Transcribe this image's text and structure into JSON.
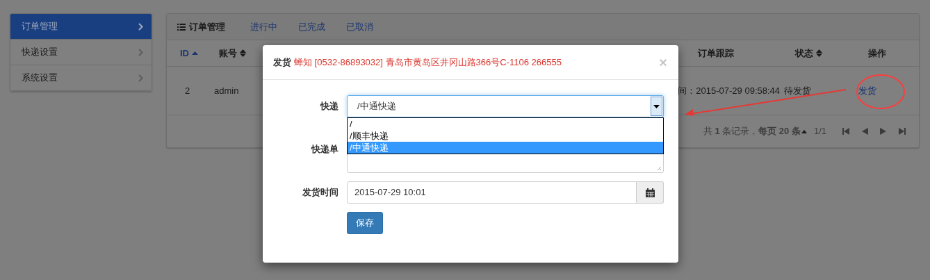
{
  "sidebar": {
    "items": [
      {
        "label": "订单管理",
        "selected": true
      },
      {
        "label": "快递设置",
        "selected": false
      },
      {
        "label": "系统设置",
        "selected": false
      }
    ]
  },
  "panel": {
    "title": "订单管理",
    "links": [
      "进行中",
      "已完成",
      "已取消"
    ]
  },
  "table": {
    "columns": [
      {
        "label": "ID",
        "sortable": true,
        "sorted_ascending": true
      },
      {
        "label": "账号",
        "sortable": true,
        "sorted_ascending": false
      },
      {
        "label": "订单跟踪",
        "sortable": false,
        "sorted_ascending": false
      },
      {
        "label": "状态",
        "sortable": true,
        "sorted_ascending": false
      },
      {
        "label": "操作",
        "sortable": false,
        "sorted_ascending": false
      }
    ],
    "rows": [
      {
        "cells": [
          "2",
          "admin",
          "间：2015-07-29 09:58:44",
          "待发货",
          "发货"
        ]
      }
    ]
  },
  "pagination": {
    "summary": "共 **1** 条记录，**每页 20 条**",
    "page": "1/1"
  },
  "modal": {
    "title": "发货",
    "subtitle": "蝉知 [0532-86893032] 青岛市黄岛区井冈山路366号C-1106 266555",
    "close": "×",
    "fields": [
      {
        "kind": "select",
        "label": "快递",
        "value": "/中通快递",
        "expanded": true,
        "options": [
          {
            "label": "/",
            "selected": false
          },
          {
            "label": "/顺丰快递",
            "selected": false
          },
          {
            "label": "/中通快递",
            "selected": true
          }
        ]
      },
      {
        "kind": "textarea",
        "label": "快递单"
      },
      {
        "kind": "datetime",
        "label": "发货时间",
        "value": "2015-07-29 10:01"
      }
    ],
    "submit": "保存"
  }
}
